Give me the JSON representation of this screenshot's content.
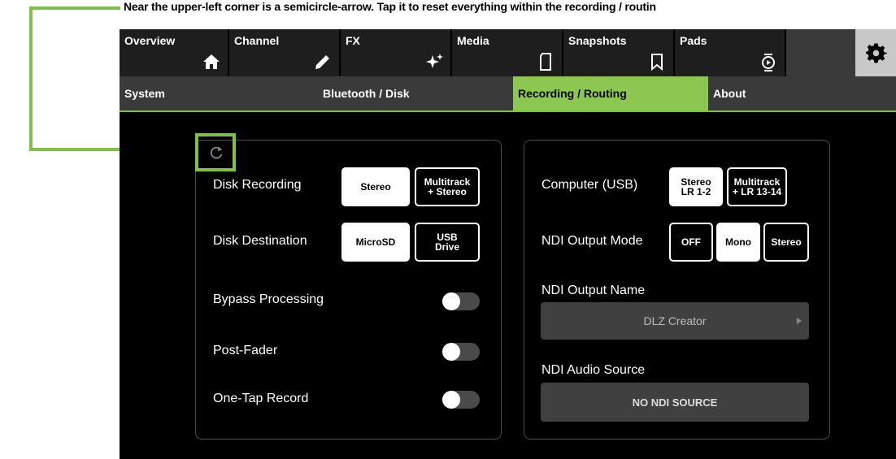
{
  "annotation": {
    "text": "Near the upper-left corner is a semicircle-arrow. Tap it to reset everything within the recording / routin"
  },
  "colors": {
    "accent": "#8cc751",
    "highlight": "#7ec04a",
    "background": "#000000"
  },
  "top_tabs": [
    {
      "label": "Overview",
      "icon": "home-icon"
    },
    {
      "label": "Channel",
      "icon": "pencil-icon"
    },
    {
      "label": "FX",
      "icon": "sparkle-icon"
    },
    {
      "label": "Media",
      "icon": "sd-card-icon"
    },
    {
      "label": "Snapshots",
      "icon": "bookmark-icon"
    },
    {
      "label": "Pads",
      "icon": "pads-icon"
    }
  ],
  "settings_icon": "gear-icon",
  "sub_tabs": [
    {
      "label": "System",
      "active": false
    },
    {
      "label": "Bluetooth / Disk",
      "active": false
    },
    {
      "label": "Recording / Routing",
      "active": true
    },
    {
      "label": "About",
      "active": false
    }
  ],
  "reset_icon": "reset-arrow-icon",
  "left_panel": {
    "disk_recording": {
      "label": "Disk Recording",
      "options": [
        "Stereo",
        "Multitrack\n+ Stereo"
      ],
      "selected": "Stereo"
    },
    "disk_destination": {
      "label": "Disk Destination",
      "options": [
        "MicroSD",
        "USB\nDrive"
      ],
      "selected": "MicroSD"
    },
    "bypass_processing": {
      "label": "Bypass Processing",
      "on": false
    },
    "post_fader": {
      "label": "Post-Fader",
      "on": false
    },
    "one_tap_record": {
      "label": "One-Tap Record",
      "on": false
    }
  },
  "right_panel": {
    "computer_usb": {
      "label": "Computer (USB)",
      "options": [
        "Stereo\nLR 1-2",
        "Multitrack\n+ LR 13-14"
      ],
      "selected": "Stereo\nLR 1-2"
    },
    "ndi_output_mode": {
      "label": "NDI Output Mode",
      "options": [
        "OFF",
        "Mono",
        "Stereo"
      ],
      "selected": "Mono"
    },
    "ndi_output_name": {
      "label": "NDI Output Name",
      "value": "DLZ Creator"
    },
    "ndi_audio_source": {
      "label": "NDI Audio Source",
      "value": "NO NDI SOURCE"
    }
  }
}
